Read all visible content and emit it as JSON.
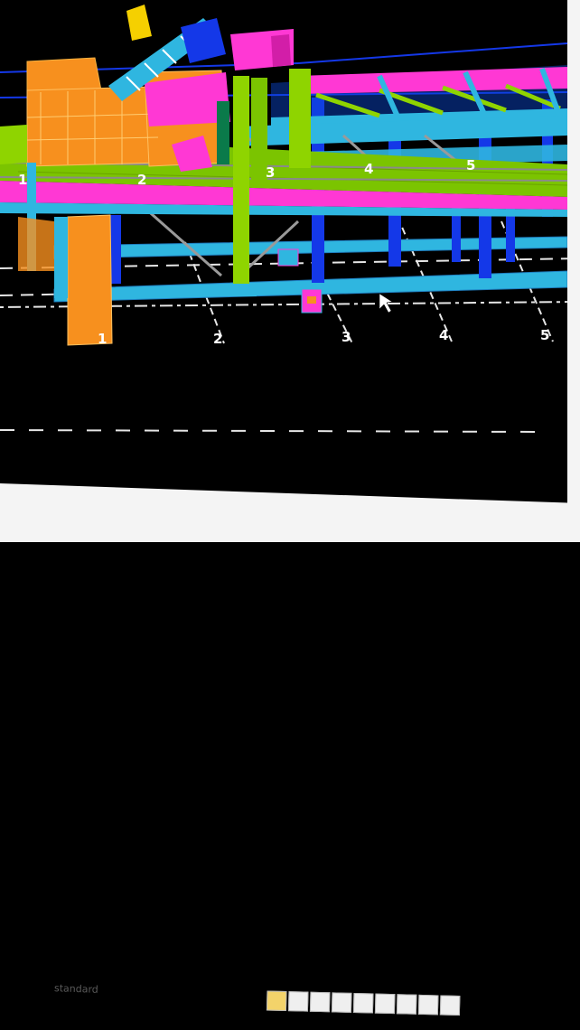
{
  "viewport": {
    "background": "#000000",
    "grid_labels": {
      "top": [
        "1",
        "2",
        "3",
        "4",
        "5"
      ],
      "bottom": [
        "1",
        "2",
        "3",
        "4",
        "5"
      ]
    },
    "colors": {
      "orange": "#f7901e",
      "green": "#8fd400",
      "magenta": "#ff38d4",
      "cyan": "#2fb6e0",
      "blue": "#1438e8",
      "gray": "#9a9a9a",
      "white_dash": "#e6e6e6"
    }
  },
  "status": {
    "style_label": "standard"
  },
  "toolbar": {
    "icons": [
      "folder-icon",
      "layer-icon",
      "grid-icon",
      "snap-icon",
      "ortho-icon",
      "polar-icon",
      "osnap-icon",
      "lineweight-icon",
      "model-icon"
    ]
  },
  "cursor": {
    "type": "arrow-cursor"
  }
}
